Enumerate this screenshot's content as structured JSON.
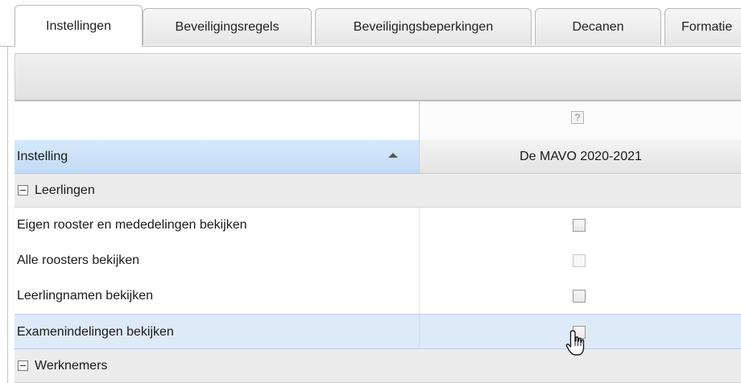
{
  "tabs": [
    {
      "label": "Instellingen",
      "active": true
    },
    {
      "label": "Beveiligingsregels"
    },
    {
      "label": "Beveiligingsbeperkingen"
    },
    {
      "label": "Decanen"
    },
    {
      "label": "Formatie"
    }
  ],
  "grid": {
    "help_label": "?",
    "column_header": "Instelling",
    "value_column": "De MAVO 2020-2021",
    "groups": [
      {
        "label": "Leerlingen",
        "expanded": true
      },
      {
        "label": "Werknemers",
        "expanded": true
      }
    ],
    "rows": [
      {
        "label": "Eigen rooster en mededelingen bekijken",
        "checked": false
      },
      {
        "label": "Alle roosters bekijken",
        "checked": false,
        "disabled": true
      },
      {
        "label": "Leerlingnamen bekijken",
        "checked": false
      },
      {
        "label": "Examenindelingen bekijken",
        "checked": false,
        "hover": true
      }
    ]
  }
}
